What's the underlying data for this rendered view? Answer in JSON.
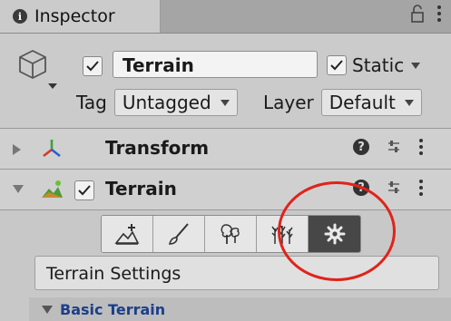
{
  "tab": {
    "title": "Inspector",
    "info_icon": "info-icon",
    "lock_icon": "lock-icon",
    "menu_icon": "kebab-menu-icon"
  },
  "object": {
    "icon": "gameobject-cube-icon",
    "active": true,
    "name": "Terrain",
    "static_label": "Static",
    "static_checked": true,
    "tag_label": "Tag",
    "tag_value": "Untagged",
    "layer_label": "Layer",
    "layer_value": "Default"
  },
  "components": [
    {
      "title": "Transform",
      "icon": "transform-axes-icon",
      "expanded": false,
      "has_checkbox": false
    },
    {
      "title": "Terrain",
      "icon": "terrain-icon",
      "expanded": true,
      "has_checkbox": true,
      "checked": true
    }
  ],
  "terrain_tools": [
    {
      "name": "raise-lower-terrain-icon",
      "active": false
    },
    {
      "name": "paint-brush-icon",
      "active": false
    },
    {
      "name": "paint-trees-icon",
      "active": false
    },
    {
      "name": "paint-details-icon",
      "active": false
    },
    {
      "name": "settings-gear-icon",
      "active": true
    }
  ],
  "settings_title": "Terrain Settings",
  "section_title": "Basic Terrain",
  "colors": {
    "highlight": "#e0231b",
    "section_label": "#1b3f8a",
    "active_tool": "#474747"
  }
}
